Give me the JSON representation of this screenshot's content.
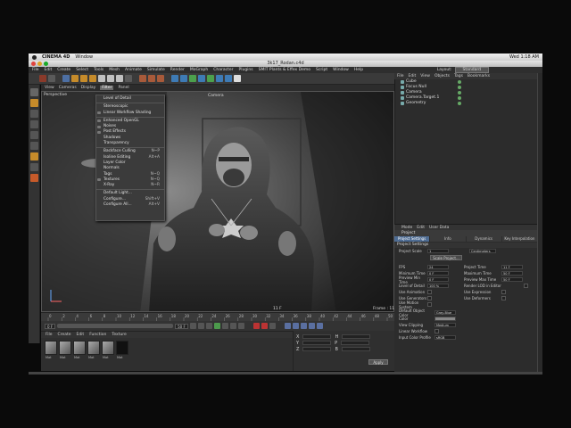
{
  "mac_menubar": {
    "app": "CINEMA 4D",
    "menu": "Window",
    "clock": "Wed 1:18 AM"
  },
  "window": {
    "title": "3k17_Rodan.c4d"
  },
  "app_menu": {
    "items": [
      "File",
      "Edit",
      "Create",
      "Select",
      "Tools",
      "Mesh",
      "Animate",
      "Simulate",
      "Render",
      "MoGraph",
      "Character",
      "Plugins",
      "SMIT Plants & Effex Demo",
      "Script",
      "Window",
      "Help"
    ],
    "layout_label": "Layout:",
    "layout_value": "Standard"
  },
  "viewport": {
    "menu": [
      "View",
      "Cameras",
      "Display",
      "Filter",
      "Panel"
    ],
    "active_menu": "Filter",
    "perspective_label": "Perspective",
    "camera_label": "Camera",
    "frame_label": "11 F",
    "frame_counter": "Frame : 11"
  },
  "filter_dropdown": {
    "items": [
      {
        "label": "Level of Detail",
        "shortcut": "",
        "checked": false,
        "sep_after": true
      },
      {
        "label": "Stereoscopic",
        "shortcut": "",
        "checked": false,
        "sep_after": false
      },
      {
        "label": "Linear Workflow Shading",
        "shortcut": "",
        "checked": true,
        "sep_after": true
      },
      {
        "label": "Enhanced OpenGL",
        "shortcut": "",
        "checked": true,
        "sep_after": false
      },
      {
        "label": "Noises",
        "shortcut": "",
        "checked": true,
        "sep_after": false
      },
      {
        "label": "Post Effects",
        "shortcut": "",
        "checked": true,
        "sep_after": false
      },
      {
        "label": "Shadows",
        "shortcut": "",
        "checked": false,
        "sep_after": false
      },
      {
        "label": "Transparency",
        "shortcut": "",
        "checked": false,
        "sep_after": true
      },
      {
        "label": "Backface Culling",
        "shortcut": "N~P",
        "checked": false,
        "sep_after": false
      },
      {
        "label": "Isoline Editing",
        "shortcut": "Alt+A",
        "checked": false,
        "sep_after": false
      },
      {
        "label": "Layer Color",
        "shortcut": "",
        "checked": false,
        "sep_after": false
      },
      {
        "label": "Normals",
        "shortcut": "",
        "checked": false,
        "sep_after": false
      },
      {
        "label": "Tags",
        "shortcut": "N~Q",
        "checked": false,
        "sep_after": false
      },
      {
        "label": "Textures",
        "shortcut": "N~Q",
        "checked": true,
        "sep_after": false
      },
      {
        "label": "X-Ray",
        "shortcut": "N~R",
        "checked": false,
        "sep_after": true
      },
      {
        "label": "Default Light...",
        "shortcut": "",
        "checked": false,
        "sep_after": false
      },
      {
        "label": "Configure...",
        "shortcut": "Shift+V",
        "checked": false,
        "sep_after": false
      },
      {
        "label": "Configure All...",
        "shortcut": "Alt+V",
        "checked": false,
        "sep_after": false
      }
    ]
  },
  "timeline": {
    "ticks": [
      "0",
      "2",
      "4",
      "6",
      "8",
      "10",
      "12",
      "14",
      "16",
      "18",
      "20",
      "22",
      "24",
      "26",
      "28",
      "30",
      "32",
      "34",
      "36",
      "38",
      "40",
      "42",
      "44",
      "46",
      "48",
      "50"
    ],
    "current": "11",
    "start_field": "0 F",
    "end_field": "50 F"
  },
  "material_panel": {
    "menu": [
      "File",
      "Create",
      "Edit",
      "Function",
      "Texture"
    ],
    "materials": [
      "Mat",
      "Mat",
      "Mat",
      "Mat",
      "Mat",
      "Mat"
    ]
  },
  "coord_panel": {
    "rows": [
      [
        "X",
        "H"
      ],
      [
        "Y",
        "P"
      ],
      [
        "Z",
        "B"
      ]
    ],
    "apply_label": "Apply"
  },
  "object_manager": {
    "menu": [
      "File",
      "Edit",
      "View",
      "Objects",
      "Tags",
      "Bookmarks"
    ],
    "objects": [
      "Cube",
      "Focus Null",
      "Camera",
      "Camera.Target.1",
      "Geometry"
    ]
  },
  "attribute_manager": {
    "menu": [
      "Mode",
      "Edit",
      "User Data"
    ],
    "title": "Project",
    "tabs": [
      "Project Settings",
      "Info",
      "Dynamics",
      "Key Interpolation"
    ],
    "active_tab": "Project Settings",
    "section": "Project Settings",
    "scale_label": "Project Scale",
    "scale_value": "1",
    "scale_unit": "Centimeters",
    "scale_button": "Scale Project...",
    "rows": [
      {
        "label": "FPS",
        "value": "24",
        "label2": "Project Time",
        "value2": "11 F"
      },
      {
        "label": "Minimum Time",
        "value": "0 F",
        "label2": "Maximum Time",
        "value2": "50 F"
      },
      {
        "label": "Preview Min Time",
        "value": "0 F",
        "label2": "Preview Max Time",
        "value2": "50 F"
      },
      {
        "label": "Level of Detail",
        "value": "100 %",
        "label2": "Render LOD in Editor",
        "value2": ""
      }
    ],
    "checks": [
      {
        "label": "Use Animation",
        "label2": "Use Expression"
      },
      {
        "label": "Use Generators",
        "label2": "Use Deformers"
      },
      {
        "label": "Use Motion System",
        "label2": ""
      }
    ],
    "default_color_label": "Default Object Color",
    "default_color_value": "Gray-Blue",
    "color_label": "Color",
    "clipping_label": "View Clipping",
    "clipping_value": "Medium",
    "linear_label": "Linear Workflow",
    "profile_label": "Input Color Profile",
    "profile_value": "sRGB"
  }
}
